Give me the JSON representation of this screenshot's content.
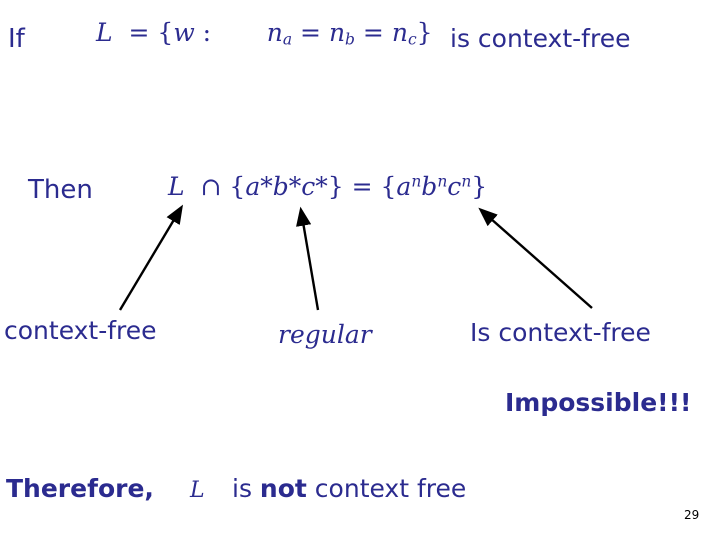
{
  "slide": {
    "if_label": "If",
    "context_free_1": "is context-free",
    "then_label": "Then",
    "language_definition": "L = { w :  n_a = n_b = n_c }",
    "intersection_equation": "L ∩ { a* b* c* } = { aⁿ bⁿ cⁿ }",
    "labels": {
      "context_free": "context-free",
      "regular": "regular",
      "is_context_free": "Is context-free",
      "impossible": "Impossible!!!"
    },
    "conclusion": {
      "therefore": "Therefore,",
      "symbol": "L",
      "rest_before": "is ",
      "emphasis": "not",
      "rest_after": " context free"
    },
    "page_number": "29",
    "colors": {
      "text": "#2b2b8f",
      "page_number": "#000000",
      "background": "#ffffff",
      "arrow": "#000000"
    }
  }
}
